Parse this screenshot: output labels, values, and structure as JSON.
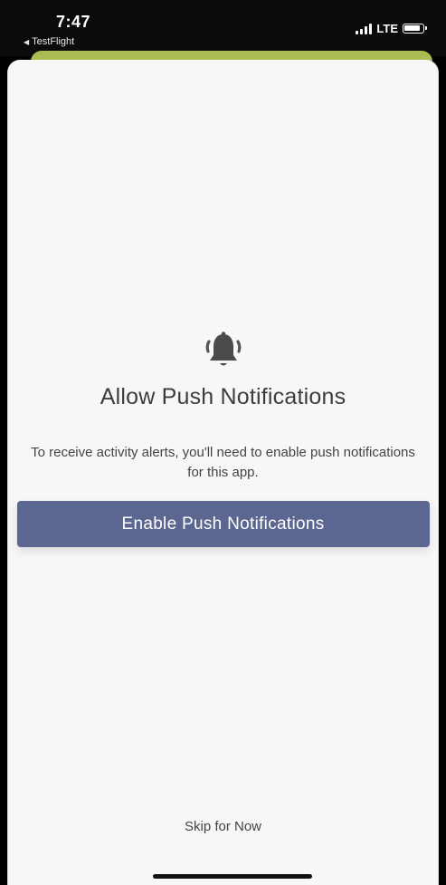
{
  "status_bar": {
    "time": "7:47",
    "back_app": "TestFlight",
    "network": "LTE"
  },
  "prompt": {
    "icon": "bell-ringing-icon",
    "title": "Allow Push Notifications",
    "description": "To receive activity alerts, you'll need to enable push notifications for this app.",
    "enable_button": "Enable Push Notifications",
    "skip_link": "Skip for Now"
  },
  "colors": {
    "button": "#5b6790",
    "background": "#f7f7f8",
    "accent_card": "#a9bd52"
  }
}
